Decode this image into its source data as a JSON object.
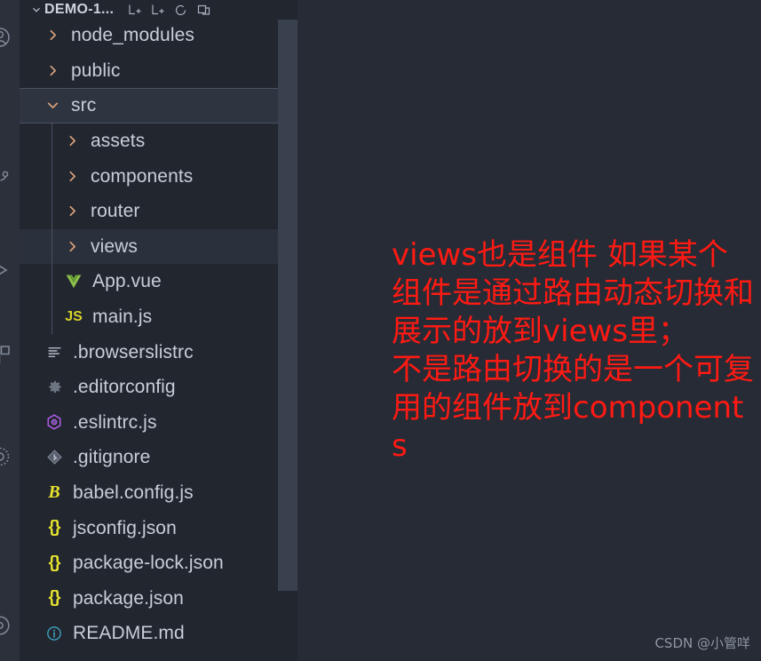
{
  "window": {
    "theme_colors": {
      "editor_background": "#262b35",
      "sidebar_background": "#21262f",
      "activitybar_background": "#2b303b",
      "selected_row_background": "#2e3440",
      "hover_row_background": "#2b313c",
      "scrollbar_thumb": "#39404e",
      "text_primary": "#c8ced9",
      "annotation_red": "#ff1a13",
      "watermark_gray": "#8e96a4"
    }
  },
  "activity_bar": {
    "items": [
      {
        "icon": "account-circle-icon"
      },
      {
        "icon": "source-control-icon"
      },
      {
        "icon": "run-and-debug-icon"
      },
      {
        "icon": "extensions-icon"
      },
      {
        "icon": "remote-explorer-icon"
      },
      {
        "icon": "settings-gear-icon"
      }
    ]
  },
  "explorer": {
    "title": "DEMO-1...",
    "collapse_chevron": "chevron-down-icon",
    "actions": [
      {
        "name": "new-file-button",
        "icon": "new-file-icon",
        "tooltip": "New File"
      },
      {
        "name": "new-folder-button",
        "icon": "new-folder-icon",
        "tooltip": "New Folder"
      },
      {
        "name": "refresh-explorer-button",
        "icon": "refresh-icon",
        "tooltip": "Refresh Explorer"
      },
      {
        "name": "collapse-folders-button",
        "icon": "collapse-all-icon",
        "tooltip": "Collapse Folders in Explorer"
      }
    ],
    "tree": [
      {
        "label": "node_modules",
        "type": "folder",
        "expanded": false,
        "depth": 1,
        "icon": "chevron-right-icon",
        "state": "normal"
      },
      {
        "label": "public",
        "type": "folder",
        "expanded": false,
        "depth": 1,
        "icon": "chevron-right-icon",
        "state": "normal"
      },
      {
        "label": "src",
        "type": "folder",
        "expanded": true,
        "depth": 1,
        "icon": "chevron-down-icon",
        "state": "selected"
      },
      {
        "label": "assets",
        "type": "folder",
        "expanded": false,
        "depth": 2,
        "icon": "chevron-right-icon",
        "state": "normal"
      },
      {
        "label": "components",
        "type": "folder",
        "expanded": false,
        "depth": 2,
        "icon": "chevron-right-icon",
        "state": "normal"
      },
      {
        "label": "router",
        "type": "folder",
        "expanded": false,
        "depth": 2,
        "icon": "chevron-right-icon",
        "state": "normal"
      },
      {
        "label": "views",
        "type": "folder",
        "expanded": false,
        "depth": 2,
        "icon": "chevron-right-icon",
        "state": "hovered"
      },
      {
        "label": "App.vue",
        "type": "file",
        "depth": 2,
        "icon": "vue-file-icon",
        "icon_color": "#8dc149",
        "state": "normal"
      },
      {
        "label": "main.js",
        "type": "file",
        "depth": 2,
        "icon": "javascript-file-icon",
        "icon_color": "#d7d32b",
        "state": "normal"
      },
      {
        "label": ".browserslistrc",
        "type": "file",
        "depth": 1,
        "icon": "config-list-icon",
        "icon_color": "#c5c9d3",
        "state": "normal"
      },
      {
        "label": ".editorconfig",
        "type": "file",
        "depth": 1,
        "icon": "gear-icon",
        "icon_color": "#6d7582",
        "state": "normal"
      },
      {
        "label": ".eslintrc.js",
        "type": "file",
        "depth": 1,
        "icon": "eslint-icon",
        "icon_color": "#b05ce6",
        "state": "normal"
      },
      {
        "label": ".gitignore",
        "type": "file",
        "depth": 1,
        "icon": "git-icon",
        "icon_color": "#6d7582",
        "state": "normal"
      },
      {
        "label": "babel.config.js",
        "type": "file",
        "depth": 1,
        "icon": "babel-icon",
        "icon_color": "#e6e22e",
        "state": "normal"
      },
      {
        "label": "jsconfig.json",
        "type": "file",
        "depth": 1,
        "icon": "json-braces-icon",
        "icon_color": "#e6e22e",
        "state": "normal"
      },
      {
        "label": "package-lock.json",
        "type": "file",
        "depth": 1,
        "icon": "json-braces-icon",
        "icon_color": "#e6e22e",
        "state": "normal"
      },
      {
        "label": "package.json",
        "type": "file",
        "depth": 1,
        "icon": "json-braces-icon",
        "icon_color": "#e6e22e",
        "state": "normal"
      },
      {
        "label": "README.md",
        "type": "file",
        "depth": 1,
        "icon": "info-circle-icon",
        "icon_color": "#42a5c4",
        "state": "normal"
      }
    ]
  },
  "editor": {
    "annotation": "views也是组件 如果某个组件是通过路由动态切换和展示的放到views里；\n不是路由切换的是一个可复用的组件放到components",
    "watermark": "CSDN @小管咩"
  }
}
